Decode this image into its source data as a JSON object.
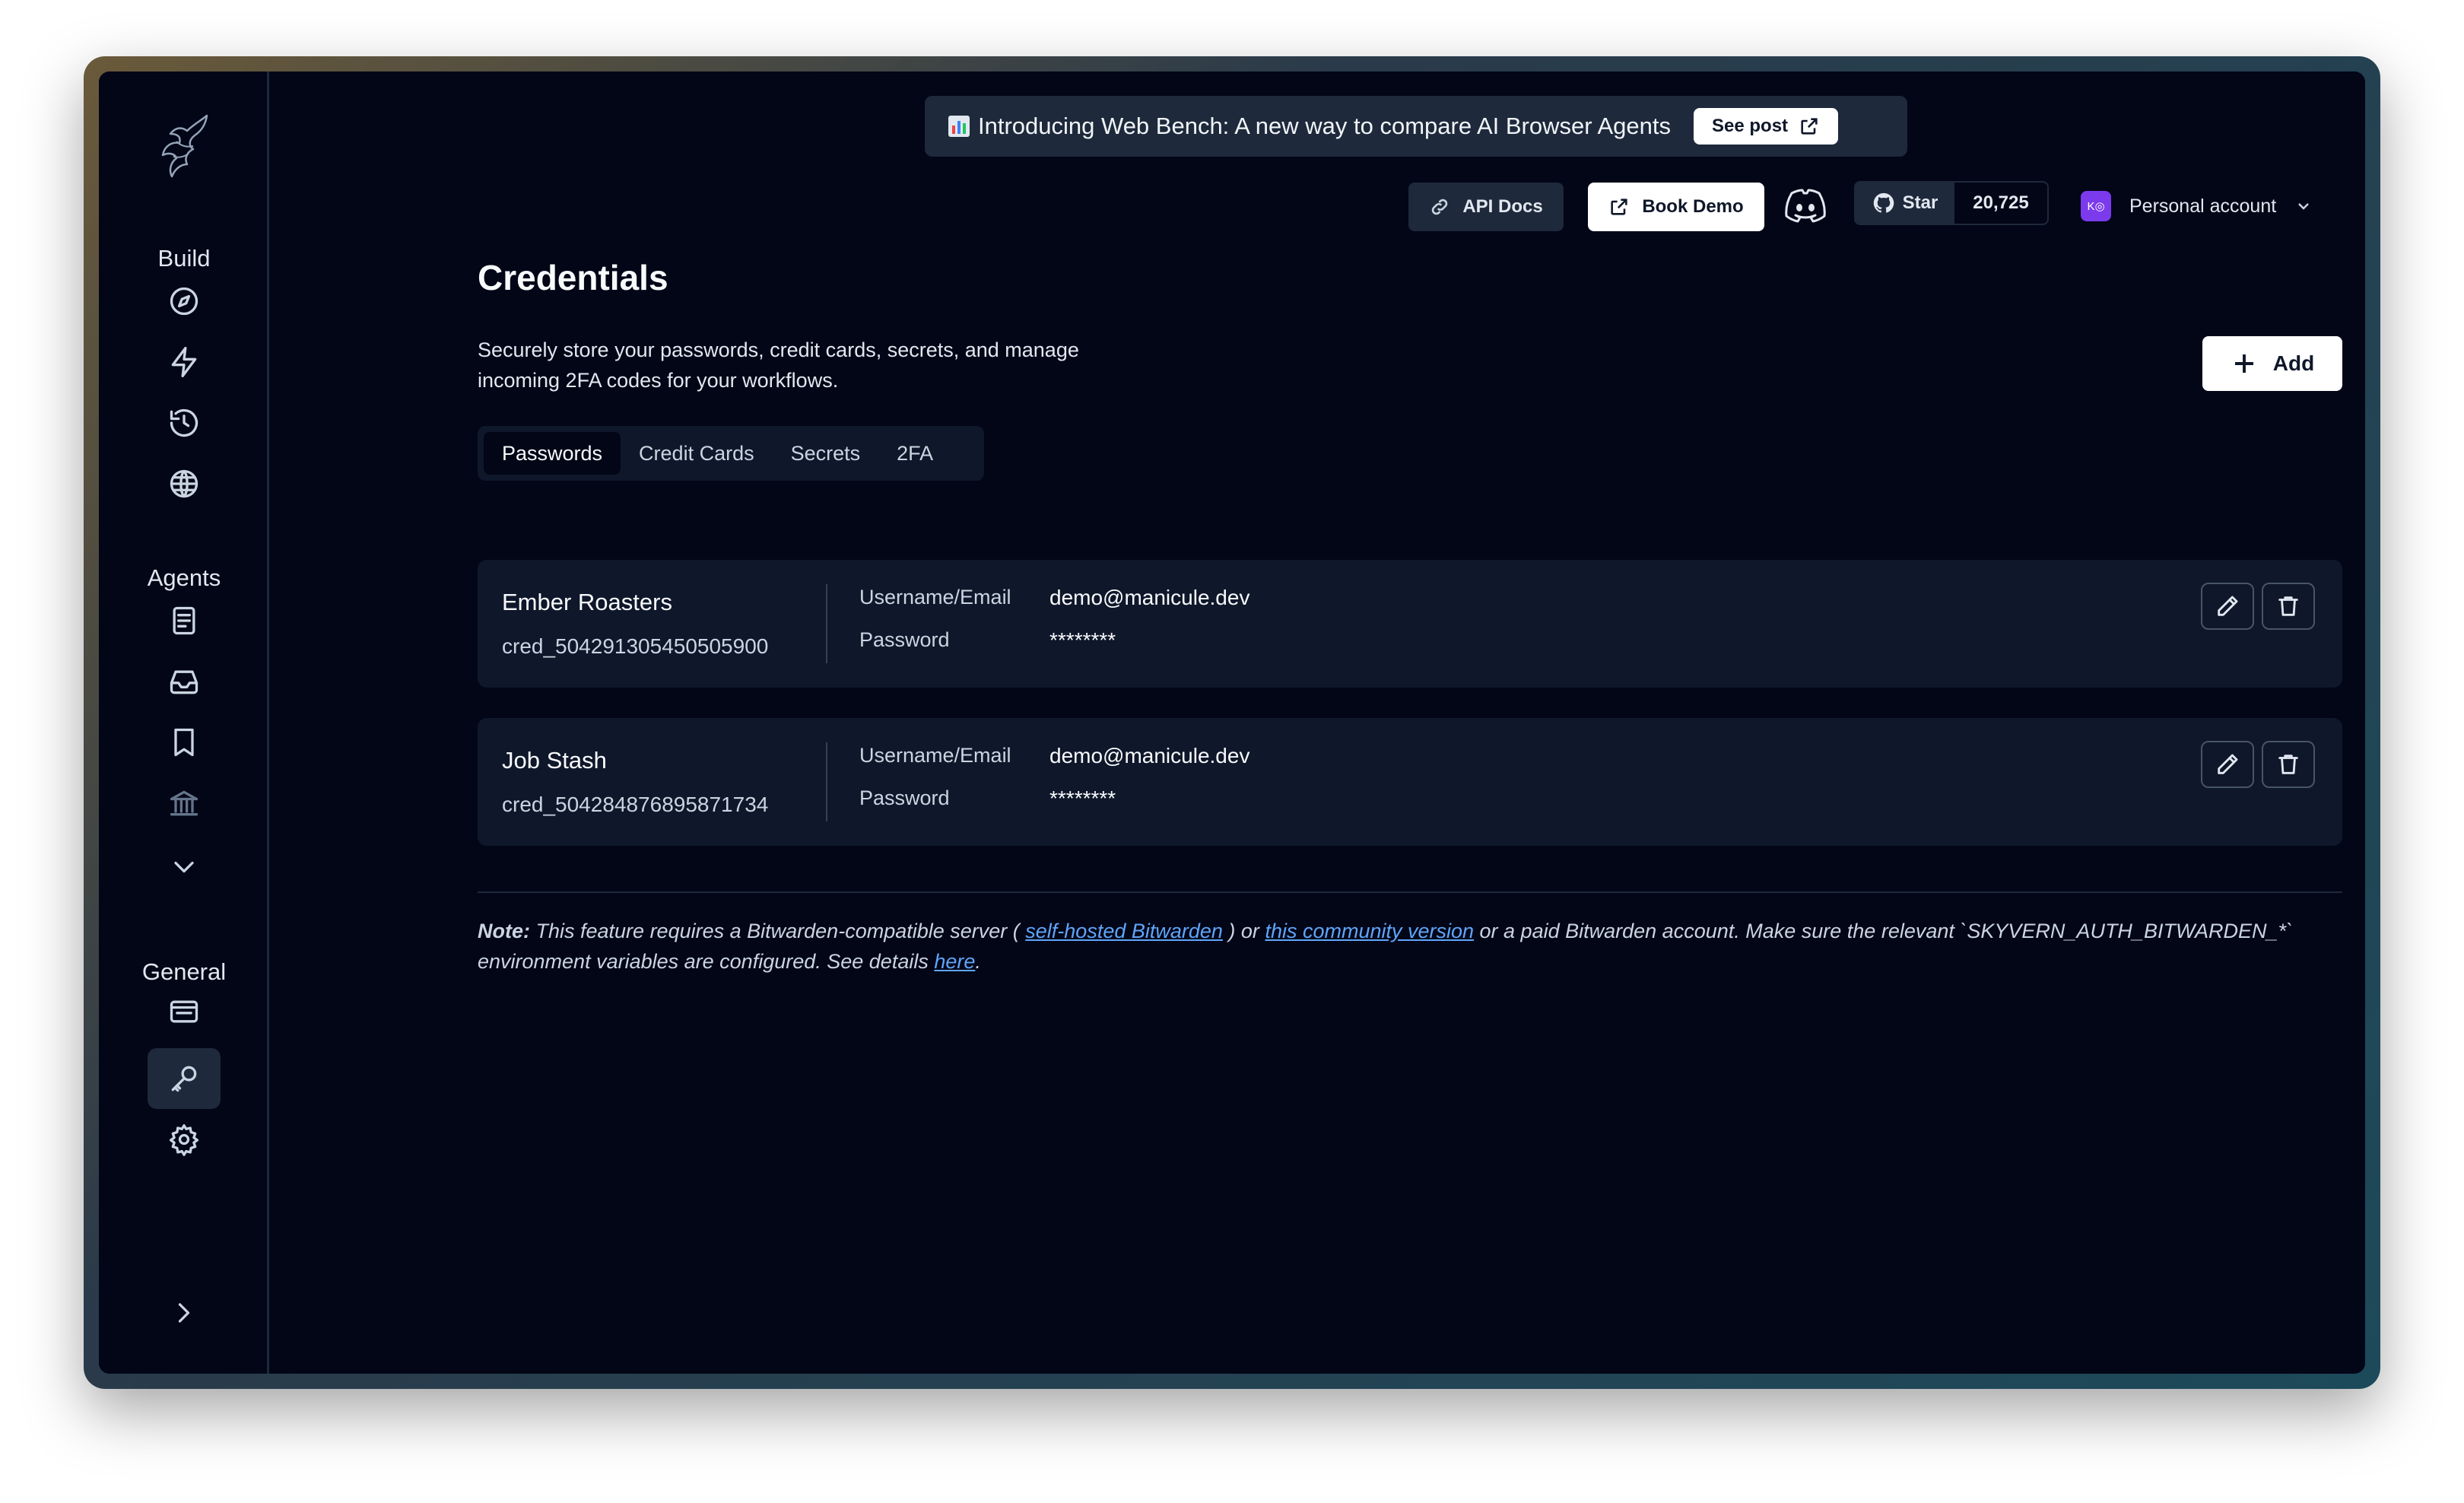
{
  "sidebar": {
    "sections": {
      "build": "Build",
      "agents": "Agents",
      "general": "General"
    },
    "icons": [
      "compass-icon",
      "bolt-icon",
      "history-icon",
      "globe-icon",
      "document-icon",
      "inbox-icon",
      "book-icon",
      "bank-icon",
      "chevron-down-icon",
      "keyboard-icon",
      "key-icon",
      "gear-icon",
      "chevron-right-icon"
    ],
    "active": "key-icon"
  },
  "banner": {
    "text": "Introducing Web Bench: A new way to compare AI Browser Agents",
    "cta": "See post"
  },
  "topbar": {
    "api_docs": "API Docs",
    "book_demo": "Book Demo",
    "github_star": "Star",
    "github_count": "20,725",
    "account_avatar": "K◎",
    "account": "Personal account"
  },
  "page": {
    "title": "Credentials",
    "description": "Securely store your passwords, credit cards, secrets, and manage incoming 2FA codes for your workflows.",
    "add_label": "Add"
  },
  "tabs": [
    {
      "label": "Passwords",
      "active": true
    },
    {
      "label": "Credit Cards",
      "active": false
    },
    {
      "label": "Secrets",
      "active": false
    },
    {
      "label": "2FA",
      "active": false
    }
  ],
  "credentials": [
    {
      "name": "Ember Roasters",
      "id": "cred_504291305450505900",
      "username_label": "Username/Email",
      "username": "demo@manicule.dev",
      "password_label": "Password",
      "password": "********"
    },
    {
      "name": "Job Stash",
      "id": "cred_504284876895871734",
      "username_label": "Username/Email",
      "username": "demo@manicule.dev",
      "password_label": "Password",
      "password": "********"
    }
  ],
  "note": {
    "prefix": "Note:",
    "part1": " This feature requires a Bitwarden-compatible server ( ",
    "link1": "self-hosted Bitwarden",
    "part2": " ) or ",
    "link2": "this community version",
    "part3": " or a paid Bitwarden account. Make sure the relevant `SKYVERN_AUTH_BITWARDEN_*` environment variables are configured. See details ",
    "link3": "here",
    "part4": "."
  },
  "colors": {
    "background": "#020617",
    "card": "#0f172a",
    "link": "#60a5fa",
    "chat_accent": "#6366f1"
  }
}
